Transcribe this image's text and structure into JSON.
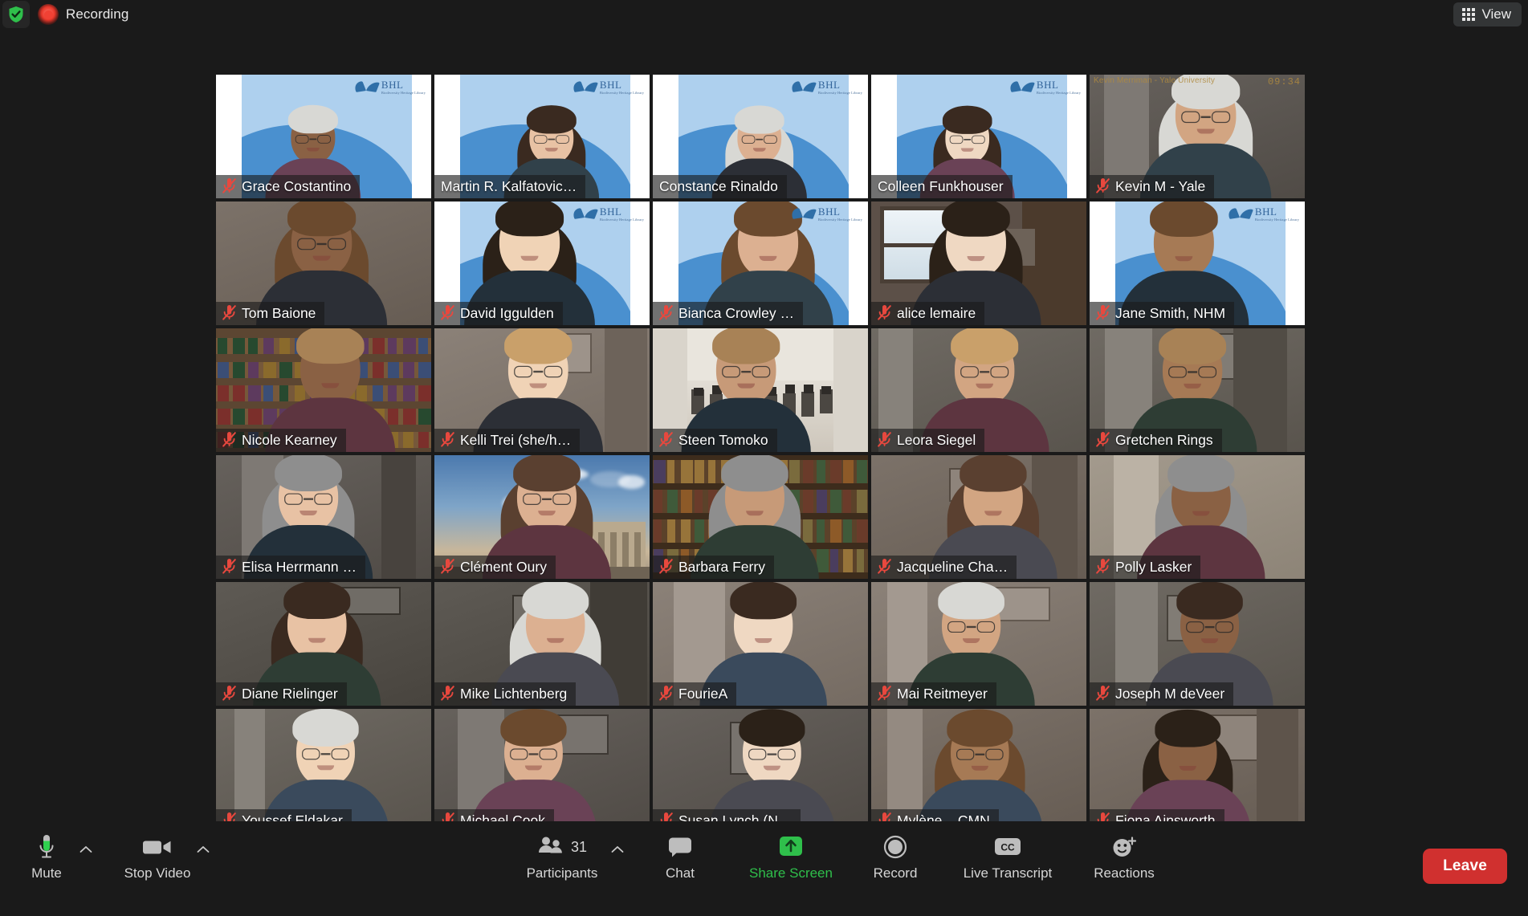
{
  "app": {
    "platform": "Zoom Meeting"
  },
  "topbar": {
    "security_icon": "shield-check-icon",
    "recording_icon": "recording-dot-icon",
    "recording_label": "Recording",
    "view_icon": "grid-view-icon",
    "view_label": "View"
  },
  "grid": {
    "columns": 5,
    "rows": 6,
    "tiles": [
      {
        "name": "Grace Costantino",
        "muted": true,
        "speaking": false,
        "background": "bhl",
        "row": 1,
        "col": 1
      },
      {
        "name": "Martin R. Kalfatovic…",
        "muted": false,
        "speaking": true,
        "background": "bhl",
        "row": 1,
        "col": 2
      },
      {
        "name": "Constance Rinaldo",
        "muted": false,
        "speaking": false,
        "background": "bhl",
        "row": 1,
        "col": 3
      },
      {
        "name": "Colleen Funkhouser",
        "muted": false,
        "speaking": false,
        "background": "bhl",
        "row": 1,
        "col": 4
      },
      {
        "name": "Kevin M - Yale",
        "muted": true,
        "speaking": false,
        "background": "room",
        "row": 1,
        "col": 5,
        "overlay_text": "Kevin Merriman - Yale University",
        "overlay_clock": "09:34"
      },
      {
        "name": "Tom Baione",
        "muted": true,
        "speaking": false,
        "background": "room",
        "row": 2,
        "col": 1
      },
      {
        "name": "David Iggulden",
        "muted": true,
        "speaking": false,
        "background": "bhl",
        "row": 2,
        "col": 2
      },
      {
        "name": "Bianca Crowley …",
        "muted": true,
        "speaking": false,
        "background": "bhl",
        "row": 2,
        "col": 3
      },
      {
        "name": "alice lemaire",
        "muted": true,
        "speaking": false,
        "background": "window",
        "row": 2,
        "col": 4
      },
      {
        "name": "Jane Smith, NHM",
        "muted": true,
        "speaking": false,
        "background": "bhl",
        "row": 2,
        "col": 5
      },
      {
        "name": "Nicole Kearney",
        "muted": true,
        "speaking": false,
        "background": "shelves",
        "row": 3,
        "col": 1
      },
      {
        "name": "Kelli Trei  (she/h…",
        "muted": true,
        "speaking": false,
        "background": "room",
        "row": 3,
        "col": 2
      },
      {
        "name": "Steen Tomoko",
        "muted": true,
        "speaking": false,
        "background": "hall",
        "row": 3,
        "col": 3
      },
      {
        "name": "Leora Siegel",
        "muted": true,
        "speaking": false,
        "background": "room",
        "row": 3,
        "col": 4
      },
      {
        "name": "Gretchen Rings",
        "muted": true,
        "speaking": false,
        "background": "room",
        "row": 3,
        "col": 5
      },
      {
        "name": "Elisa Herrmann …",
        "muted": true,
        "speaking": false,
        "background": "room",
        "row": 4,
        "col": 1
      },
      {
        "name": "Clément Oury",
        "muted": true,
        "speaking": false,
        "background": "sky",
        "row": 4,
        "col": 2
      },
      {
        "name": "Barbara Ferry",
        "muted": true,
        "speaking": false,
        "background": "books",
        "row": 4,
        "col": 3
      },
      {
        "name": "Jacqueline Cha…",
        "muted": true,
        "speaking": false,
        "background": "room",
        "row": 4,
        "col": 4
      },
      {
        "name": "Polly Lasker",
        "muted": true,
        "speaking": false,
        "background": "room",
        "row": 4,
        "col": 5
      },
      {
        "name": "Diane Rielinger",
        "muted": true,
        "speaking": false,
        "background": "room",
        "row": 5,
        "col": 1
      },
      {
        "name": "Mike Lichtenberg",
        "muted": true,
        "speaking": false,
        "background": "room",
        "row": 5,
        "col": 2
      },
      {
        "name": "FourieA",
        "muted": true,
        "speaking": false,
        "background": "room",
        "row": 5,
        "col": 3
      },
      {
        "name": "Mai Reitmeyer",
        "muted": true,
        "speaking": false,
        "background": "room",
        "row": 5,
        "col": 4
      },
      {
        "name": "Joseph M deVeer",
        "muted": true,
        "speaking": false,
        "background": "room",
        "row": 5,
        "col": 5
      },
      {
        "name": "Youssef Eldakar",
        "muted": true,
        "speaking": false,
        "background": "room",
        "row": 6,
        "col": 1
      },
      {
        "name": "Michael Cook",
        "muted": true,
        "speaking": false,
        "background": "room",
        "row": 6,
        "col": 2
      },
      {
        "name": "Susan Lynch (N…",
        "muted": true,
        "speaking": false,
        "background": "room",
        "row": 6,
        "col": 3
      },
      {
        "name": "Mylène _ CMN",
        "muted": true,
        "speaking": false,
        "background": "room",
        "row": 6,
        "col": 4
      },
      {
        "name": "Fiona Ainsworth",
        "muted": true,
        "speaking": false,
        "background": "room",
        "row": 6,
        "col": 5
      }
    ]
  },
  "toolbar": {
    "mute_icon": "microphone-icon",
    "mute_label": "Mute",
    "mute_caret_icon": "chevron-up-icon",
    "video_icon": "video-camera-icon",
    "video_label": "Stop Video",
    "video_caret_icon": "chevron-up-icon",
    "participants_icon": "participants-icon",
    "participants_count": "31",
    "participants_label": "Participants",
    "participants_caret_icon": "chevron-up-icon",
    "chat_icon": "chat-bubble-icon",
    "chat_label": "Chat",
    "share_icon": "share-screen-arrow-icon",
    "share_label": "Share Screen",
    "record_icon": "record-circle-icon",
    "record_label": "Record",
    "transcript_icon": "closed-caption-icon",
    "transcript_label": "Live Transcript",
    "reactions_icon": "reactions-smiley-icon",
    "reactions_label": "Reactions",
    "leave_label": "Leave"
  },
  "colors": {
    "app_background": "#1a1a1a",
    "accent_green": "#2fbf4b",
    "leave_red": "#d0302f",
    "speaking_border": "#c4e85a",
    "mute_red": "#e8483e",
    "bhl_light_blue": "#aed0ee",
    "bhl_blue": "#4a90cf"
  }
}
